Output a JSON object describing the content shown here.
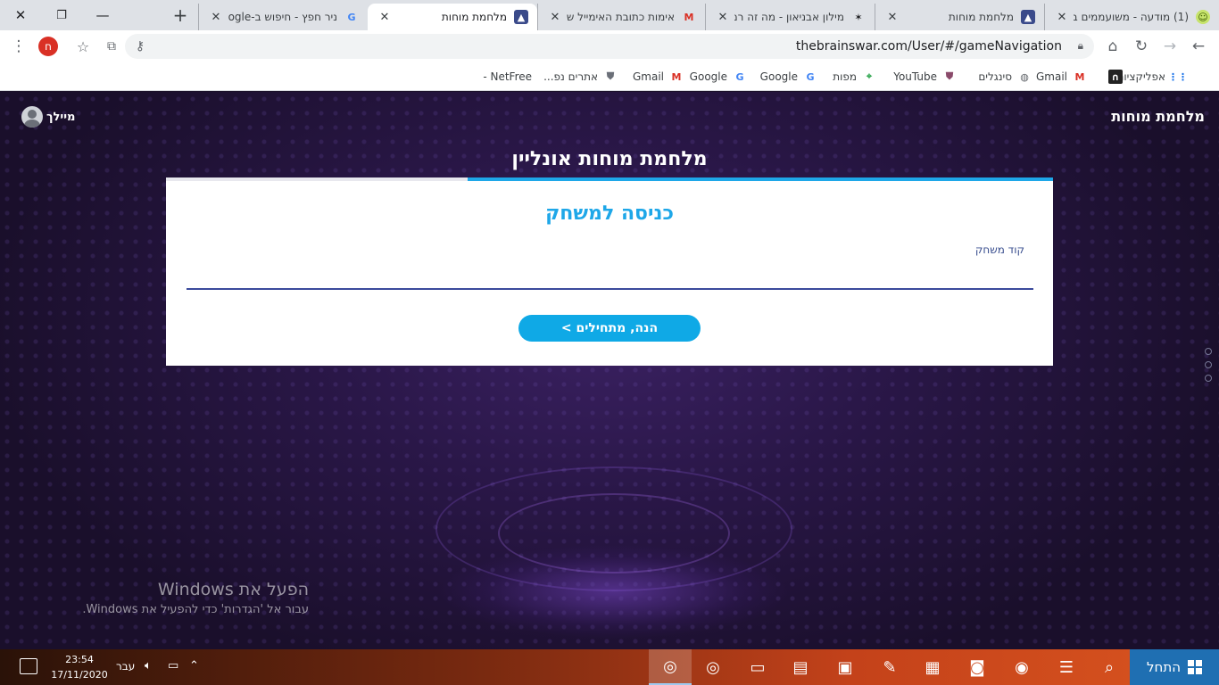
{
  "browser": {
    "tabs": [
      {
        "title": "ניר חפץ - חיפוש ב-Google",
        "favicon": "google-icon",
        "active": false
      },
      {
        "title": "מלחמת מוחות",
        "favicon": "brainswar-icon",
        "active": true
      },
      {
        "title": "אימות כתובת האימייל של",
        "favicon": "gmail-icon",
        "active": false
      },
      {
        "title": "מילון אבניאון - מה זה רמ",
        "favicon": "avneon-icon",
        "active": false
      },
      {
        "title": "מלחמת מוחות",
        "favicon": "brainswar-icon",
        "active": false
      },
      {
        "title": "(1) מודעה - משועממים ב",
        "favicon": "lime-icon",
        "active": false
      }
    ],
    "url": "thebrainswar.com/User/#/gameNavigation",
    "profile_initial": "ח",
    "bookmarks": [
      {
        "label": "אפליקציות",
        "icon": "apps-icon"
      },
      {
        "label": "",
        "icon": "bookmark-icon"
      },
      {
        "label": "Gmail",
        "icon": "gmail-icon"
      },
      {
        "label": "סינגלים",
        "icon": "globe-icon"
      },
      {
        "label": "YouTube",
        "icon": "shield-icon"
      },
      {
        "label": "מפות",
        "icon": "maps-icon"
      },
      {
        "label": "Google",
        "icon": "google-icon"
      },
      {
        "label": "Google",
        "icon": "google-icon"
      },
      {
        "label": "Gmail",
        "icon": "gmail-icon"
      },
      {
        "label": "אתרים נפ...",
        "icon": "shield-icon"
      },
      {
        "label": "NetFree - ",
        "icon": ""
      }
    ]
  },
  "site": {
    "brand": "מלחמת מוחות",
    "user_label": "מיילך"
  },
  "game": {
    "title": "מלחמת מוחות אונליין",
    "progress_fraction": 0.66,
    "heading": "כניסה למשחק",
    "code_label": "קוד משחק",
    "code_value": "",
    "start_button": "הנה, מתחילים >"
  },
  "watermark": {
    "line1": "הפעל את Windows",
    "line2": "עבור אל 'הגדרות' כדי להפעיל את Windows."
  },
  "taskbar": {
    "start_label": "התחל",
    "time": "23:54",
    "date": "17/11/2020",
    "language": "עבר"
  },
  "colors": {
    "accent": "#1ea7e8",
    "button": "#0fa9e6",
    "input_underline": "#3b4a9c",
    "page_background": "#2a1748"
  }
}
